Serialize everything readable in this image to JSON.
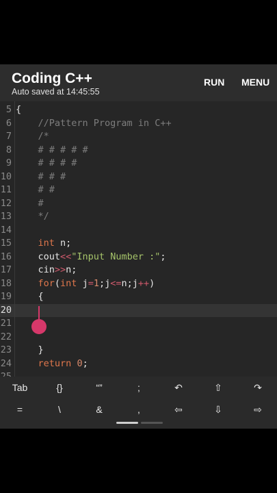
{
  "header": {
    "title": "Coding C++",
    "subtitle": "Auto saved at 14:45:55",
    "run_label": "RUN",
    "menu_label": "MENU"
  },
  "editor": {
    "current_line": "20",
    "lines": [
      {
        "num": "5",
        "parts": [
          {
            "t": "{",
            "c": ""
          }
        ]
      },
      {
        "num": "6",
        "parts": [
          {
            "t": "    //Pattern Program in C++",
            "c": "comment"
          }
        ]
      },
      {
        "num": "7",
        "parts": [
          {
            "t": "    /*",
            "c": "comment"
          }
        ]
      },
      {
        "num": "8",
        "parts": [
          {
            "t": "    # # # # #",
            "c": "comment"
          }
        ]
      },
      {
        "num": "9",
        "parts": [
          {
            "t": "    # # # #",
            "c": "comment"
          }
        ]
      },
      {
        "num": "10",
        "parts": [
          {
            "t": "    # # #",
            "c": "comment"
          }
        ]
      },
      {
        "num": "11",
        "parts": [
          {
            "t": "    # #",
            "c": "comment"
          }
        ]
      },
      {
        "num": "12",
        "parts": [
          {
            "t": "    #",
            "c": "comment"
          }
        ]
      },
      {
        "num": "13",
        "parts": [
          {
            "t": "    */",
            "c": "comment"
          }
        ]
      },
      {
        "num": "14",
        "parts": []
      },
      {
        "num": "15",
        "parts": [
          {
            "t": "    ",
            "c": ""
          },
          {
            "t": "int",
            "c": "keyword"
          },
          {
            "t": " n;",
            "c": ""
          }
        ]
      },
      {
        "num": "16",
        "parts": [
          {
            "t": "    cout",
            "c": ""
          },
          {
            "t": "<<",
            "c": "operator"
          },
          {
            "t": "\"Input Number :\"",
            "c": "string"
          },
          {
            "t": ";",
            "c": ""
          }
        ]
      },
      {
        "num": "17",
        "parts": [
          {
            "t": "    cin",
            "c": ""
          },
          {
            "t": ">>",
            "c": "operator"
          },
          {
            "t": "n;",
            "c": ""
          }
        ]
      },
      {
        "num": "18",
        "parts": [
          {
            "t": "    ",
            "c": ""
          },
          {
            "t": "for",
            "c": "keyword"
          },
          {
            "t": "(",
            "c": ""
          },
          {
            "t": "int",
            "c": "keyword"
          },
          {
            "t": " j",
            "c": ""
          },
          {
            "t": "=",
            "c": "operator"
          },
          {
            "t": "1",
            "c": "number"
          },
          {
            "t": ";j",
            "c": ""
          },
          {
            "t": "<=",
            "c": "operator"
          },
          {
            "t": "n;j",
            "c": ""
          },
          {
            "t": "++",
            "c": "operator"
          },
          {
            "t": ")",
            "c": ""
          }
        ]
      },
      {
        "num": "19",
        "parts": [
          {
            "t": "    {",
            "c": ""
          }
        ]
      },
      {
        "num": "20",
        "parts": []
      },
      {
        "num": "21",
        "parts": []
      },
      {
        "num": "22",
        "parts": []
      },
      {
        "num": "23",
        "parts": [
          {
            "t": "    }",
            "c": ""
          }
        ]
      },
      {
        "num": "24",
        "parts": [
          {
            "t": "    ",
            "c": ""
          },
          {
            "t": "return",
            "c": "keyword"
          },
          {
            "t": " ",
            "c": ""
          },
          {
            "t": "0",
            "c": "number"
          },
          {
            "t": ";",
            "c": ""
          }
        ]
      },
      {
        "num": "25",
        "parts": []
      }
    ]
  },
  "keys": {
    "row1": [
      {
        "label": "Tab",
        "name": "key-tab"
      },
      {
        "label": "{}",
        "name": "key-braces"
      },
      {
        "label": "“”",
        "name": "key-quotes"
      },
      {
        "label": ";",
        "name": "key-semicolon"
      },
      {
        "label": "↶",
        "name": "undo-icon"
      },
      {
        "label": "⇧",
        "name": "arrow-up-icon"
      },
      {
        "label": "↷",
        "name": "redo-icon"
      }
    ],
    "row2": [
      {
        "label": "=",
        "name": "key-equals"
      },
      {
        "label": "\\",
        "name": "key-backslash"
      },
      {
        "label": "&",
        "name": "key-ampersand"
      },
      {
        "label": ",",
        "name": "key-comma"
      },
      {
        "label": "⇦",
        "name": "arrow-left-icon"
      },
      {
        "label": "⇩",
        "name": "arrow-down-icon"
      },
      {
        "label": "⇨",
        "name": "arrow-right-icon"
      }
    ]
  },
  "colors": {
    "accent": "#d6386a",
    "keyword": "#e0774c",
    "comment": "#7d7d7d",
    "string": "#a6c46a"
  }
}
